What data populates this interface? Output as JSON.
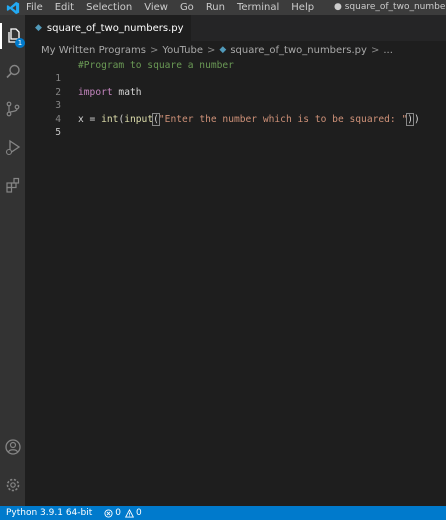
{
  "menu": {
    "items": [
      "File",
      "Edit",
      "Selection",
      "View",
      "Go",
      "Run",
      "Terminal",
      "Help"
    ],
    "window_title": "● square_of_two_numbers.py"
  },
  "activity": {
    "explorer_badge": "1"
  },
  "tab": {
    "filename": "square_of_two_numbers.py",
    "icon_glyph": "◆"
  },
  "breadcrumb": {
    "parts": [
      "My Written Programs",
      "YouTube",
      "square_of_two_numbers.py",
      "..."
    ],
    "separator": ">"
  },
  "editor": {
    "lines": [
      {
        "number": "1",
        "comment": "#Program to square a number"
      },
      {
        "number": "2"
      },
      {
        "number": "3",
        "keyword": "import",
        "rest": " math"
      },
      {
        "number": "4"
      },
      {
        "number": "5",
        "var": "x",
        "eq": " = ",
        "fn1": "int",
        "p1": "(",
        "fn2": "input",
        "p2": "(",
        "str": "\"Enter the number which is to be squared: \"",
        "p3": ")",
        "p4": ")"
      }
    ]
  },
  "status": {
    "python": "Python 3.9.1 64-bit",
    "errors": "0",
    "warnings": "0"
  },
  "colors": {
    "status_bar": "#007acc",
    "editor_bg": "#1e1e1e",
    "comment": "#6a9955",
    "keyword": "#c586c0",
    "function": "#dcdcaa",
    "string": "#ce9178"
  }
}
